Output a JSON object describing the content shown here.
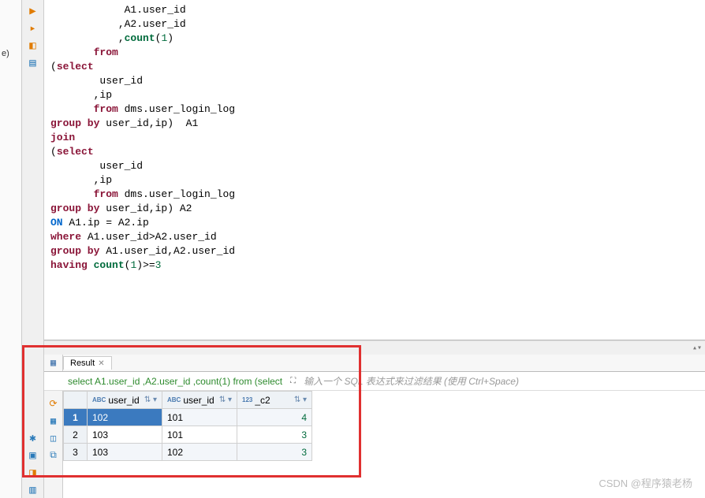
{
  "editor": {
    "lines": [
      {
        "i": 12,
        "t": [
          "            A1.user_id"
        ]
      },
      {
        "i": 12,
        "t": [
          "           ,A2.user_id"
        ]
      },
      {
        "i": 12,
        "t": [
          "           ,",
          {
            "c": "fn",
            "v": "count"
          },
          "(",
          {
            "c": "num",
            "v": "1"
          },
          ")"
        ]
      },
      {
        "i": 8,
        "t": [
          "       ",
          {
            "c": "kw",
            "v": "from"
          }
        ]
      },
      {
        "i": 4,
        "t": [
          "(",
          {
            "c": "kw",
            "v": "select"
          }
        ]
      },
      {
        "i": 8,
        "t": [
          "        user_id"
        ]
      },
      {
        "i": 8,
        "t": [
          "       ,ip"
        ]
      },
      {
        "i": 8,
        "t": [
          "       ",
          {
            "c": "kw",
            "v": "from"
          },
          " dms.user_login_log"
        ]
      },
      {
        "i": 4,
        "t": [
          {
            "c": "kw",
            "v": "group by"
          },
          " user_id,ip)  A1"
        ]
      },
      {
        "i": 4,
        "t": [
          {
            "c": "kw",
            "v": "join"
          }
        ]
      },
      {
        "i": 4,
        "t": [
          "(",
          {
            "c": "kw",
            "v": "select"
          }
        ]
      },
      {
        "i": 8,
        "t": [
          "        user_id"
        ]
      },
      {
        "i": 8,
        "t": [
          "       ,ip"
        ]
      },
      {
        "i": 8,
        "t": [
          "       ",
          {
            "c": "kw",
            "v": "from"
          },
          " dms.user_login_log"
        ]
      },
      {
        "i": 4,
        "t": [
          {
            "c": "kw",
            "v": "group by"
          },
          " user_id,ip) A2"
        ]
      },
      {
        "i": 4,
        "t": [
          {
            "c": "kw2",
            "v": "ON"
          },
          " A1.ip = A2.ip"
        ]
      },
      {
        "i": 4,
        "t": [
          {
            "c": "kw",
            "v": "where"
          },
          " A1.user_id>A2.user_id"
        ]
      },
      {
        "i": 4,
        "t": [
          ""
        ]
      },
      {
        "i": 4,
        "t": [
          {
            "c": "kw",
            "v": "group by"
          },
          " A1.user_id,A2.user_id"
        ]
      },
      {
        "i": 4,
        "t": [
          {
            "c": "kw",
            "v": "having"
          },
          " ",
          {
            "c": "fn",
            "v": "count"
          },
          "(",
          {
            "c": "num",
            "v": "1"
          },
          ")>=",
          {
            "c": "num",
            "v": "3"
          }
        ]
      }
    ]
  },
  "side_hint": "e)",
  "result": {
    "tab": "Result",
    "sql_preview": "select A1.user_id ,A2.user_id ,count(1) from (select",
    "filter_hint": "输入一个 SQL 表达式来过滤结果 (使用 Ctrl+Space)",
    "columns": [
      {
        "type": "ABC",
        "name": "user_id"
      },
      {
        "type": "ABC",
        "name": "user_id"
      },
      {
        "type": "123",
        "name": "_c2"
      }
    ],
    "rows": [
      {
        "n": "1",
        "sel": true,
        "cells": [
          "102",
          "101",
          "4"
        ]
      },
      {
        "n": "2",
        "sel": false,
        "cells": [
          "103",
          "101",
          "3"
        ]
      },
      {
        "n": "3",
        "sel": false,
        "cells": [
          "103",
          "102",
          "3"
        ]
      }
    ]
  },
  "watermark": "CSDN @程序猿老杨"
}
